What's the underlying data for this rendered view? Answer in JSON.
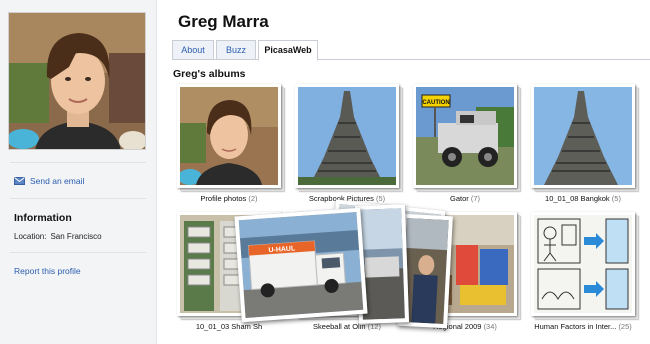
{
  "profile": {
    "name": "Greg Marra",
    "send_email": "Send an email",
    "information_heading": "Information",
    "location_label": "Location:",
    "location_value": "San Francisco",
    "report": "Report this profile"
  },
  "tabs": [
    {
      "label": "About",
      "active": false
    },
    {
      "label": "Buzz",
      "active": false
    },
    {
      "label": "PicasaWeb",
      "active": true
    }
  ],
  "albums_heading": "Greg's albums",
  "albums": [
    {
      "title": "Profile photos",
      "count": "(2)"
    },
    {
      "title": "Scrapbook Pictures",
      "count": "(5)"
    },
    {
      "title": "Gator",
      "count": "(7)"
    },
    {
      "title": "10_01_08 Bangkok",
      "count": "(5)"
    },
    {
      "title": "10_01_03 Sham Sh",
      "count": ""
    },
    {
      "title": "Skeeball at Olin",
      "count": "(12)"
    },
    {
      "title": "Regional 2009",
      "count": "(34)"
    },
    {
      "title": "Human Factors in Inter...",
      "count": "(25)"
    }
  ],
  "photo_text": {
    "caution": "CAUTION",
    "uhaul": "U-HAUL"
  },
  "colors": {
    "link": "#2a5db0",
    "sidebar_bg": "#f3f4f6",
    "tab_border": "#c9ced6"
  }
}
